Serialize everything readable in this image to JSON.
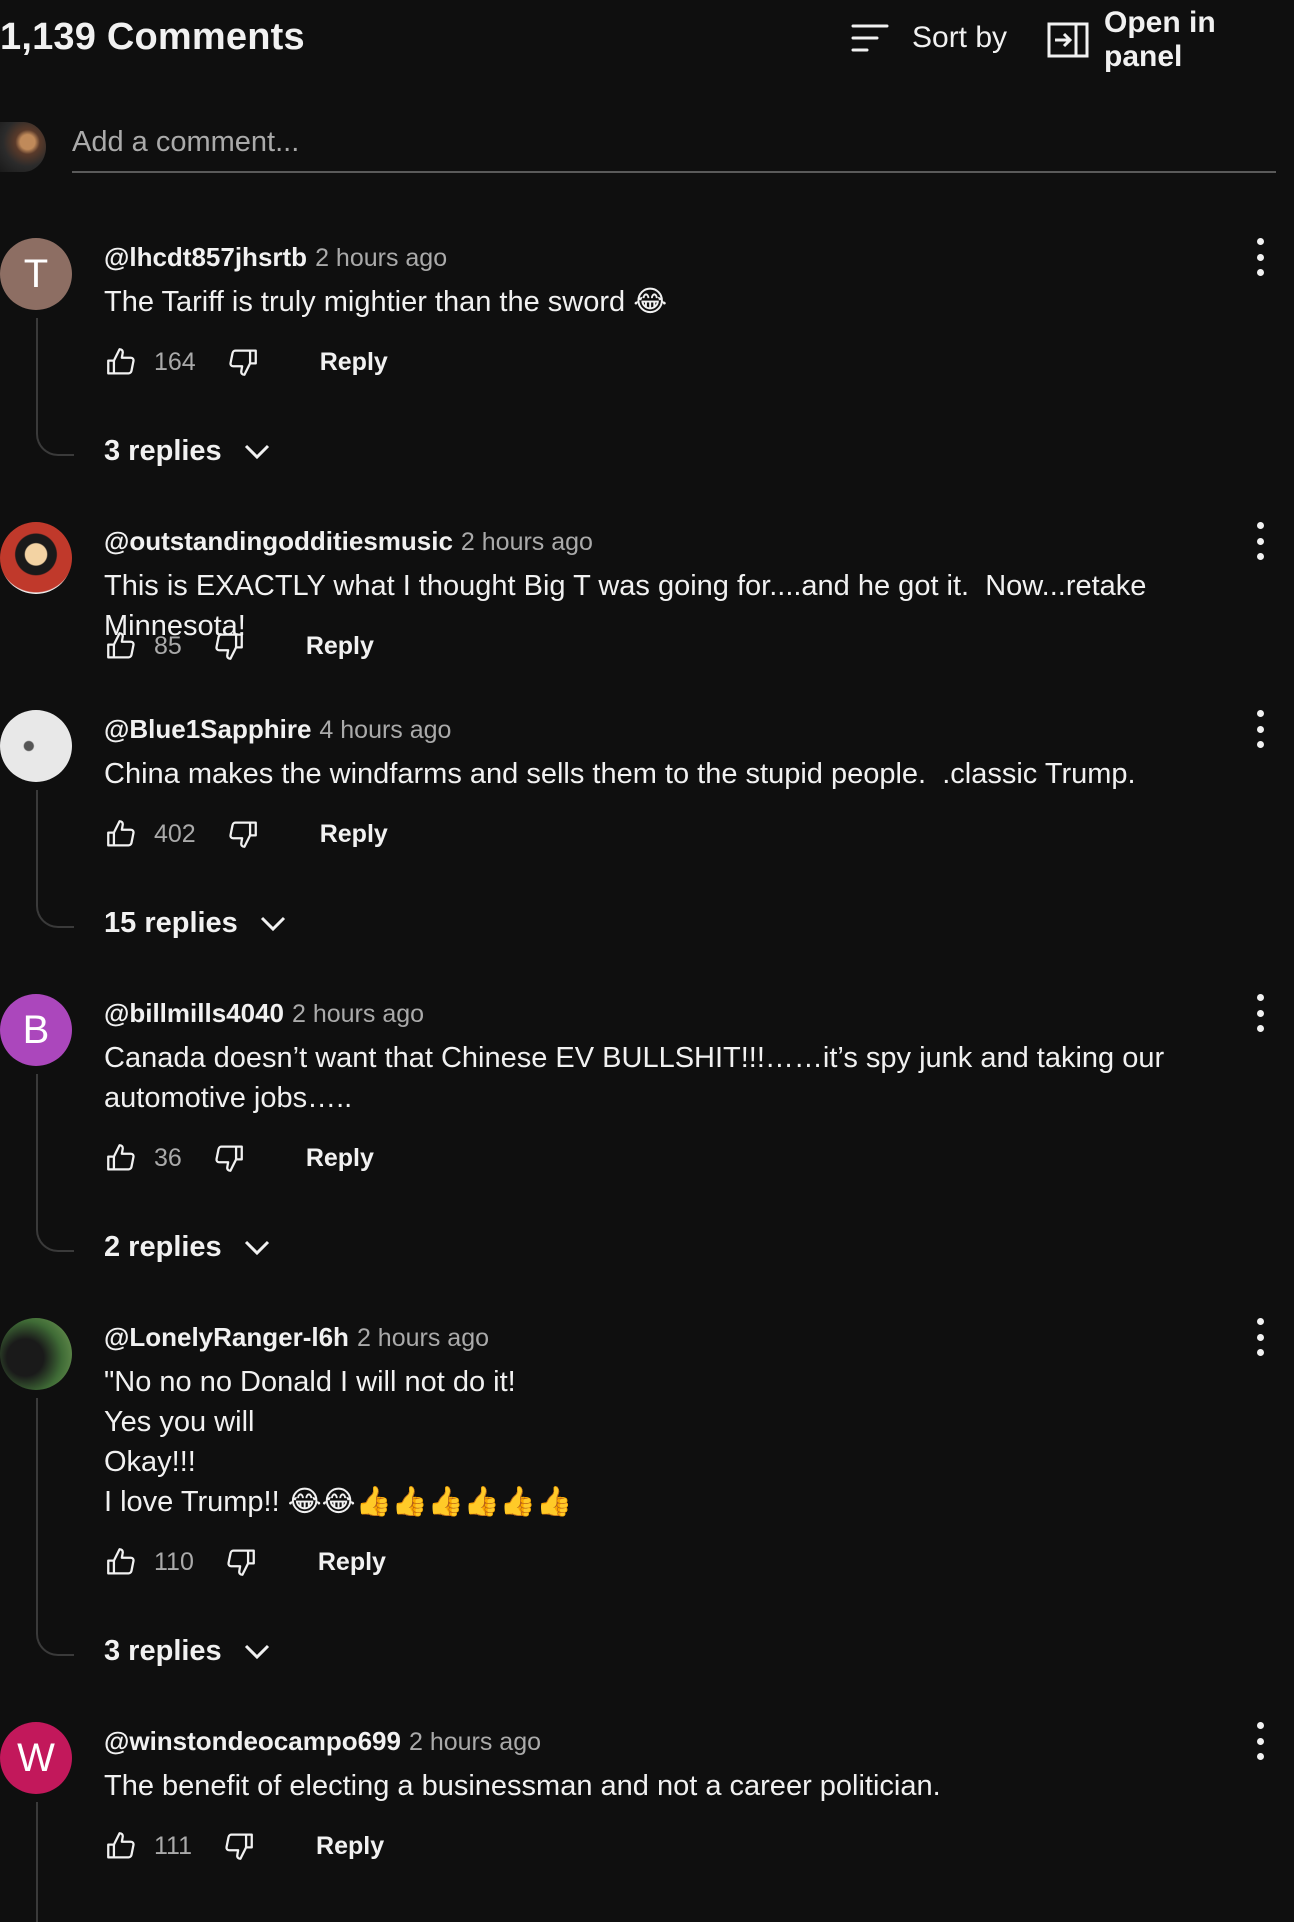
{
  "header": {
    "count": "1,139 Comments",
    "sort_label": "Sort by",
    "panel_label": "Open in panel"
  },
  "add_comment": {
    "placeholder": "Add a comment..."
  },
  "comments": [
    {
      "handle": "@lhcdt857jhsrtb",
      "time": "2 hours ago",
      "text": "The Tariff is truly mightier than the sword 😂",
      "likes": "164",
      "reply": "Reply",
      "replies": "3 replies",
      "avatar_letter": "T",
      "avatar_color": "#8d6e63"
    },
    {
      "handle": "@outstandingodditiesmusic",
      "time": "2 hours ago",
      "text": "This is EXACTLY what I thought Big T was going for....and he got it.  Now...retake Minnesota!",
      "likes": "85",
      "reply": "Reply",
      "replies": "",
      "avatar_letter": "",
      "avatar_color": "#c0392b"
    },
    {
      "handle": "@Blue1Sapphire",
      "time": "4 hours ago",
      "text": "China makes the windfarms and sells them to the stupid people.  .classic Trump.",
      "likes": "402",
      "reply": "Reply",
      "replies": "15 replies",
      "avatar_letter": "",
      "avatar_color": "#e8e8e8"
    },
    {
      "handle": "@billmills4040",
      "time": "2 hours ago",
      "text": "Canada doesn’t want that Chinese EV BULLSHIT!!!……it’s spy junk and taking our automotive jobs…..",
      "likes": "36",
      "reply": "Reply",
      "replies": "2 replies",
      "avatar_letter": "B",
      "avatar_color": "#ab47bc"
    },
    {
      "handle": "@LonelyRanger-l6h",
      "time": "2 hours ago",
      "text": "\"No no no Donald I will not do it!\nYes you will\nOkay!!!\nI love Trump!! 😂😂👍👍👍👍👍👍",
      "likes": "110",
      "reply": "Reply",
      "replies": "3 replies",
      "avatar_letter": "",
      "avatar_color": "#2e4a2a"
    },
    {
      "handle": "@winstondeocampo699",
      "time": "2 hours ago",
      "text": "The benefit of electing a businessman and not a career politician.",
      "likes": "111",
      "reply": "Reply",
      "replies": "",
      "avatar_letter": "W",
      "avatar_color": "#c2185b"
    }
  ],
  "icons": {
    "sort": "sort-icon",
    "panel": "open-in-panel-icon",
    "like": "thumb-up-icon",
    "dislike": "thumb-down-icon",
    "expand": "chevron-down-icon",
    "more": "more-vert-icon"
  }
}
